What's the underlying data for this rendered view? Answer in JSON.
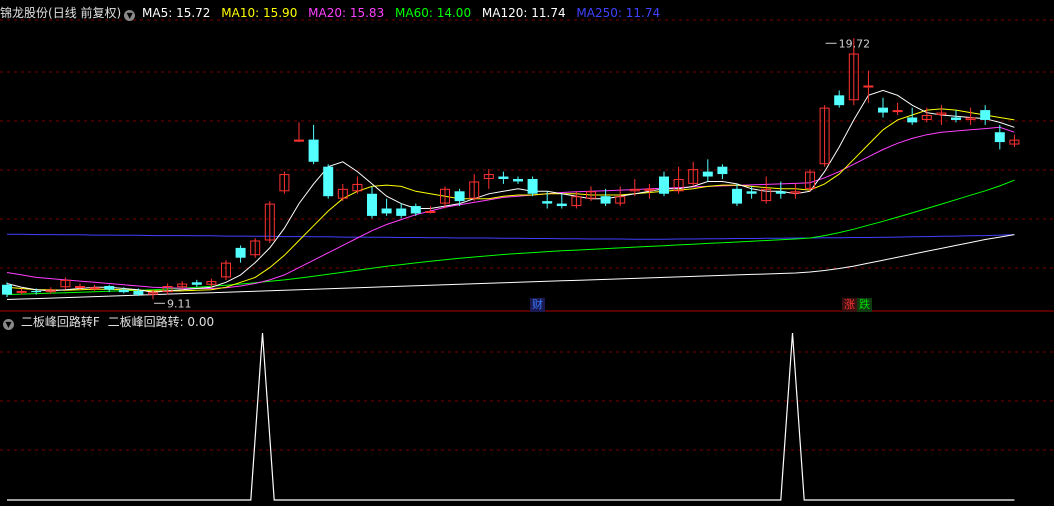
{
  "main_header": {
    "stock_name": "锦龙股份",
    "period": "(日线 前复权)",
    "ma": [
      {
        "label": "MA5: 15.72",
        "color": "#ffffff"
      },
      {
        "label": "MA10: 15.90",
        "color": "#ffff00"
      },
      {
        "label": "MA20: 15.83",
        "color": "#ff40ff"
      },
      {
        "label": "MA60: 14.00",
        "color": "#00ff00"
      },
      {
        "label": "MA120: 11.74",
        "color": "#ffffff"
      },
      {
        "label": "MA250: 11.74",
        "color": "#4040ff"
      }
    ]
  },
  "sub_header": {
    "indicator": "二板峰回路转F",
    "value_label": "二板峰回路转: 0.00"
  },
  "events": [
    {
      "label": "财",
      "color": "#3a78ff"
    },
    {
      "label": "涨",
      "color": "#ff3232"
    },
    {
      "label": "跌",
      "color": "#00dd00"
    }
  ],
  "chart_data": [
    {
      "type": "candlestick",
      "panel": "main",
      "price_range": [
        9.0,
        20.3
      ],
      "annotations": [
        {
          "text": "9.11",
          "index": 10,
          "value": 9.11,
          "kind": "low"
        },
        {
          "text": "19.72",
          "index": 56,
          "value": 19.72,
          "kind": "high"
        }
      ],
      "candles": [
        [
          9.7,
          9.3,
          9.8,
          9.2
        ],
        [
          9.4,
          9.45,
          9.55,
          9.3
        ],
        [
          9.45,
          9.4,
          9.55,
          9.3
        ],
        [
          9.4,
          9.5,
          9.6,
          9.35
        ],
        [
          9.6,
          9.9,
          10.0,
          9.5
        ],
        [
          9.6,
          9.65,
          9.75,
          9.5
        ],
        [
          9.55,
          9.6,
          9.7,
          9.45
        ],
        [
          9.65,
          9.5,
          9.7,
          9.4
        ],
        [
          9.5,
          9.4,
          9.6,
          9.35
        ],
        [
          9.45,
          9.3,
          9.55,
          9.25
        ],
        [
          9.3,
          9.4,
          9.5,
          9.11
        ],
        [
          9.4,
          9.65,
          9.75,
          9.3
        ],
        [
          9.6,
          9.75,
          9.85,
          9.5
        ],
        [
          9.8,
          9.7,
          9.9,
          9.6
        ],
        [
          9.7,
          9.85,
          9.95,
          9.6
        ],
        [
          10.0,
          10.6,
          10.7,
          9.9
        ],
        [
          11.2,
          10.8,
          11.3,
          10.6
        ],
        [
          10.9,
          11.5,
          11.6,
          10.8
        ],
        [
          11.5,
          13.0,
          13.1,
          11.4
        ],
        [
          13.5,
          14.2,
          14.3,
          13.4
        ],
        [
          15.6,
          15.6,
          16.3,
          15.5
        ],
        [
          15.6,
          14.7,
          16.2,
          14.6
        ],
        [
          14.5,
          13.3,
          14.6,
          13.2
        ],
        [
          13.2,
          13.6,
          13.8,
          13.1
        ],
        [
          13.5,
          13.8,
          14.1,
          13.4
        ],
        [
          13.4,
          12.5,
          13.7,
          12.4
        ],
        [
          12.8,
          12.6,
          13.2,
          12.5
        ],
        [
          12.8,
          12.5,
          13.0,
          12.4
        ],
        [
          12.9,
          12.6,
          13.0,
          12.5
        ],
        [
          12.7,
          12.7,
          12.9,
          12.6
        ],
        [
          13.0,
          13.6,
          13.7,
          12.8
        ],
        [
          13.5,
          13.1,
          13.6,
          12.9
        ],
        [
          13.2,
          13.9,
          14.2,
          13.1
        ],
        [
          14.0,
          14.2,
          14.4,
          13.6
        ],
        [
          14.1,
          14.0,
          14.3,
          13.8
        ],
        [
          14.0,
          13.9,
          14.1,
          13.8
        ],
        [
          14.0,
          13.4,
          14.1,
          13.3
        ],
        [
          13.1,
          13.0,
          13.5,
          12.8
        ],
        [
          13.0,
          12.9,
          13.4,
          12.8
        ],
        [
          12.9,
          13.3,
          13.5,
          12.8
        ],
        [
          13.2,
          13.5,
          13.7,
          13.1
        ],
        [
          13.3,
          13.0,
          13.6,
          12.9
        ],
        [
          13.0,
          13.3,
          13.7,
          12.9
        ],
        [
          13.5,
          13.6,
          14.0,
          13.3
        ],
        [
          13.6,
          13.6,
          13.8,
          13.2
        ],
        [
          14.1,
          13.4,
          14.3,
          13.3
        ],
        [
          13.5,
          14.0,
          14.5,
          13.4
        ],
        [
          13.8,
          14.4,
          14.7,
          13.7
        ],
        [
          14.3,
          14.1,
          14.8,
          13.9
        ],
        [
          14.5,
          14.2,
          14.6,
          14.0
        ],
        [
          13.6,
          13.0,
          13.8,
          12.9
        ],
        [
          13.5,
          13.4,
          13.7,
          13.2
        ],
        [
          13.1,
          13.6,
          14.1,
          13.0
        ],
        [
          13.5,
          13.4,
          13.9,
          13.2
        ],
        [
          13.4,
          13.5,
          13.8,
          13.2
        ],
        [
          13.6,
          14.3,
          14.4,
          13.5
        ],
        [
          14.6,
          16.9,
          17.0,
          14.5
        ],
        [
          17.4,
          17.0,
          17.6,
          16.9
        ],
        [
          17.2,
          19.1,
          19.72,
          17.0
        ],
        [
          17.8,
          17.8,
          18.4,
          17.1
        ],
        [
          16.9,
          16.7,
          17.3,
          16.5
        ],
        [
          16.8,
          16.8,
          17.1,
          16.6
        ],
        [
          16.5,
          16.3,
          16.9,
          16.2
        ],
        [
          16.4,
          16.6,
          16.9,
          16.3
        ],
        [
          16.6,
          16.7,
          17.0,
          16.2
        ],
        [
          16.5,
          16.4,
          16.8,
          16.3
        ],
        [
          16.4,
          16.5,
          16.9,
          16.2
        ],
        [
          16.8,
          16.4,
          17.0,
          16.2
        ],
        [
          15.9,
          15.5,
          16.2,
          15.2
        ],
        [
          15.4,
          15.6,
          15.8,
          15.3
        ]
      ],
      "series": [
        {
          "name": "MA5",
          "color": "#ffffff",
          "values": [
            9.75,
            9.6,
            9.5,
            9.45,
            9.5,
            9.55,
            9.6,
            9.6,
            9.55,
            9.5,
            9.4,
            9.45,
            9.5,
            9.55,
            9.6,
            9.8,
            10.1,
            10.6,
            11.2,
            12.0,
            13.0,
            13.8,
            14.5,
            14.7,
            14.3,
            13.8,
            13.3,
            13.0,
            12.8,
            12.8,
            12.9,
            13.0,
            13.2,
            13.4,
            13.5,
            13.6,
            13.5,
            13.5,
            13.4,
            13.3,
            13.2,
            13.2,
            13.3,
            13.4,
            13.5,
            13.6,
            13.6,
            13.7,
            13.9,
            13.9,
            13.8,
            13.6,
            13.5,
            13.5,
            13.4,
            13.5,
            14.3,
            15.3,
            16.4,
            17.4,
            17.6,
            17.4,
            17.0,
            16.7,
            16.6,
            16.55,
            16.5,
            16.45,
            16.3,
            16.1
          ]
        },
        {
          "name": "MA10",
          "color": "#ffff00",
          "values": [
            9.6,
            9.55,
            9.5,
            9.5,
            9.48,
            9.5,
            9.52,
            9.52,
            9.5,
            9.48,
            9.45,
            9.45,
            9.45,
            9.48,
            9.5,
            9.6,
            9.8,
            10.0,
            10.4,
            10.9,
            11.5,
            12.1,
            12.7,
            13.2,
            13.5,
            13.7,
            13.75,
            13.7,
            13.5,
            13.4,
            13.3,
            13.2,
            13.2,
            13.2,
            13.3,
            13.35,
            13.35,
            13.4,
            13.4,
            13.4,
            13.35,
            13.35,
            13.35,
            13.4,
            13.45,
            13.5,
            13.55,
            13.6,
            13.7,
            13.75,
            13.75,
            13.7,
            13.65,
            13.6,
            13.6,
            13.55,
            13.8,
            14.2,
            14.8,
            15.4,
            16.0,
            16.4,
            16.6,
            16.8,
            16.85,
            16.8,
            16.7,
            16.6,
            16.5,
            16.4
          ]
        },
        {
          "name": "MA20",
          "color": "#ff40ff",
          "values": [
            10.2,
            10.1,
            10.0,
            9.95,
            9.9,
            9.85,
            9.8,
            9.75,
            9.7,
            9.65,
            9.6,
            9.58,
            9.56,
            9.55,
            9.55,
            9.58,
            9.65,
            9.75,
            9.9,
            10.1,
            10.4,
            10.7,
            11.0,
            11.3,
            11.6,
            11.9,
            12.15,
            12.35,
            12.55,
            12.7,
            12.85,
            12.95,
            13.05,
            13.15,
            13.25,
            13.3,
            13.35,
            13.4,
            13.45,
            13.48,
            13.5,
            13.52,
            13.55,
            13.57,
            13.6,
            13.62,
            13.65,
            13.68,
            13.7,
            13.72,
            13.74,
            13.76,
            13.78,
            13.8,
            13.82,
            13.85,
            14.05,
            14.3,
            14.6,
            14.9,
            15.2,
            15.45,
            15.65,
            15.8,
            15.9,
            15.95,
            16.0,
            16.05,
            16.1,
            15.9
          ]
        },
        {
          "name": "MA60",
          "color": "#00ff00",
          "values": [
            9.3,
            9.32,
            9.34,
            9.36,
            9.38,
            9.4,
            9.42,
            9.44,
            9.46,
            9.48,
            9.5,
            9.53,
            9.56,
            9.6,
            9.64,
            9.68,
            9.73,
            9.78,
            9.84,
            9.9,
            9.97,
            10.05,
            10.13,
            10.21,
            10.29,
            10.37,
            10.45,
            10.52,
            10.59,
            10.66,
            10.72,
            10.78,
            10.83,
            10.88,
            10.93,
            10.97,
            11.01,
            11.05,
            11.08,
            11.11,
            11.14,
            11.17,
            11.2,
            11.23,
            11.26,
            11.29,
            11.32,
            11.35,
            11.38,
            11.41,
            11.44,
            11.47,
            11.5,
            11.53,
            11.56,
            11.6,
            11.7,
            11.82,
            11.96,
            12.12,
            12.28,
            12.45,
            12.62,
            12.8,
            12.98,
            13.16,
            13.34,
            13.52,
            13.72,
            13.95
          ]
        },
        {
          "name": "MA120",
          "color": "#ffffff",
          "values": [
            9.1,
            9.12,
            9.14,
            9.16,
            9.18,
            9.2,
            9.22,
            9.24,
            9.26,
            9.28,
            9.3,
            9.32,
            9.34,
            9.36,
            9.38,
            9.4,
            9.42,
            9.44,
            9.46,
            9.48,
            9.5,
            9.52,
            9.54,
            9.56,
            9.58,
            9.6,
            9.62,
            9.64,
            9.66,
            9.68,
            9.7,
            9.72,
            9.74,
            9.76,
            9.78,
            9.8,
            9.82,
            9.84,
            9.86,
            9.88,
            9.9,
            9.92,
            9.94,
            9.96,
            9.98,
            10.0,
            10.02,
            10.04,
            10.06,
            10.08,
            10.1,
            10.12,
            10.14,
            10.16,
            10.18,
            10.22,
            10.28,
            10.36,
            10.46,
            10.58,
            10.7,
            10.82,
            10.94,
            11.06,
            11.18,
            11.3,
            11.42,
            11.54,
            11.64,
            11.74
          ]
        },
        {
          "name": "MA250",
          "color": "#4040ff",
          "values": [
            11.75,
            11.75,
            11.74,
            11.74,
            11.73,
            11.73,
            11.72,
            11.72,
            11.71,
            11.71,
            11.7,
            11.7,
            11.7,
            11.69,
            11.69,
            11.68,
            11.68,
            11.67,
            11.67,
            11.66,
            11.66,
            11.65,
            11.65,
            11.64,
            11.64,
            11.63,
            11.63,
            11.62,
            11.62,
            11.61,
            11.61,
            11.6,
            11.6,
            11.6,
            11.59,
            11.59,
            11.58,
            11.58,
            11.57,
            11.57,
            11.56,
            11.56,
            11.56,
            11.55,
            11.55,
            11.55,
            11.56,
            11.56,
            11.57,
            11.57,
            11.58,
            11.58,
            11.59,
            11.59,
            11.6,
            11.6,
            11.61,
            11.61,
            11.62,
            11.62,
            11.63,
            11.64,
            11.65,
            11.66,
            11.67,
            11.68,
            11.69,
            11.7,
            11.72,
            11.74
          ]
        }
      ]
    },
    {
      "type": "line",
      "panel": "indicator",
      "name": "二板峰回路转",
      "color": "#ffffff",
      "ylim": [
        0,
        1
      ],
      "x": [
        0,
        16.7,
        17.5,
        18.3,
        53.0,
        53.8,
        54.6,
        69
      ],
      "values": [
        0,
        0,
        1,
        0,
        0,
        1,
        0,
        0
      ]
    }
  ]
}
